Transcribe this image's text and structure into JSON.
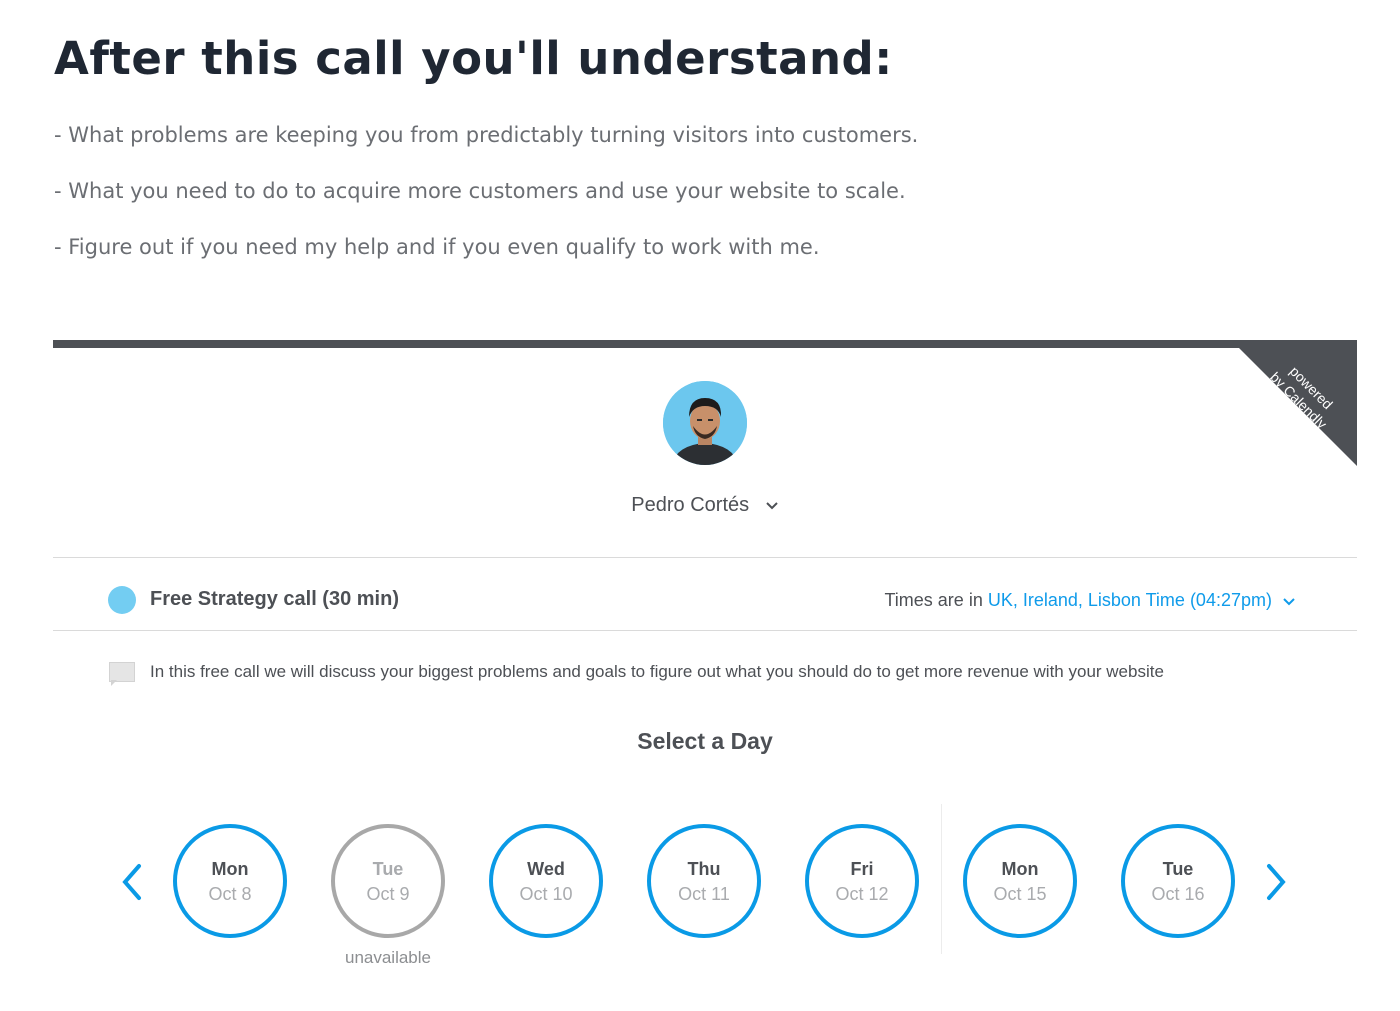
{
  "header": {
    "title": "After this call you'll understand:",
    "bullets": [
      "- What problems are keeping you from predictably turning visitors into customers.",
      "- What you need to do to acquire more customers and use your website to scale.",
      "- Figure out if you need my help and if you even qualify to work with me."
    ]
  },
  "widget": {
    "badge": {
      "line1": "powered",
      "line2": "by Calendly"
    },
    "host": {
      "name": "Pedro Cortés",
      "chevron": "chevron-down-icon"
    },
    "event": {
      "title": "Free Strategy call (30 min)",
      "color": "#73cdf2",
      "timezone_prefix": "Times are in",
      "timezone_value": "UK, Ireland, Lisbon Time (04:27pm)"
    },
    "description": "In this free call we will discuss your biggest problems and goals to figure out what you should do to get more revenue with your website",
    "select_day_label": "Select a Day",
    "days": [
      {
        "dow": "Mon",
        "date": "Oct 8"
      },
      {
        "dow": "Tue",
        "date": "Oct 9",
        "status": "unavailable"
      },
      {
        "dow": "Wed",
        "date": "Oct 10"
      },
      {
        "dow": "Thu",
        "date": "Oct 11"
      },
      {
        "dow": "Fri",
        "date": "Oct 12"
      },
      {
        "dow": "Mon",
        "date": "Oct 15"
      },
      {
        "dow": "Tue",
        "date": "Oct 16"
      }
    ],
    "accent_color": "#0a9ae6"
  }
}
